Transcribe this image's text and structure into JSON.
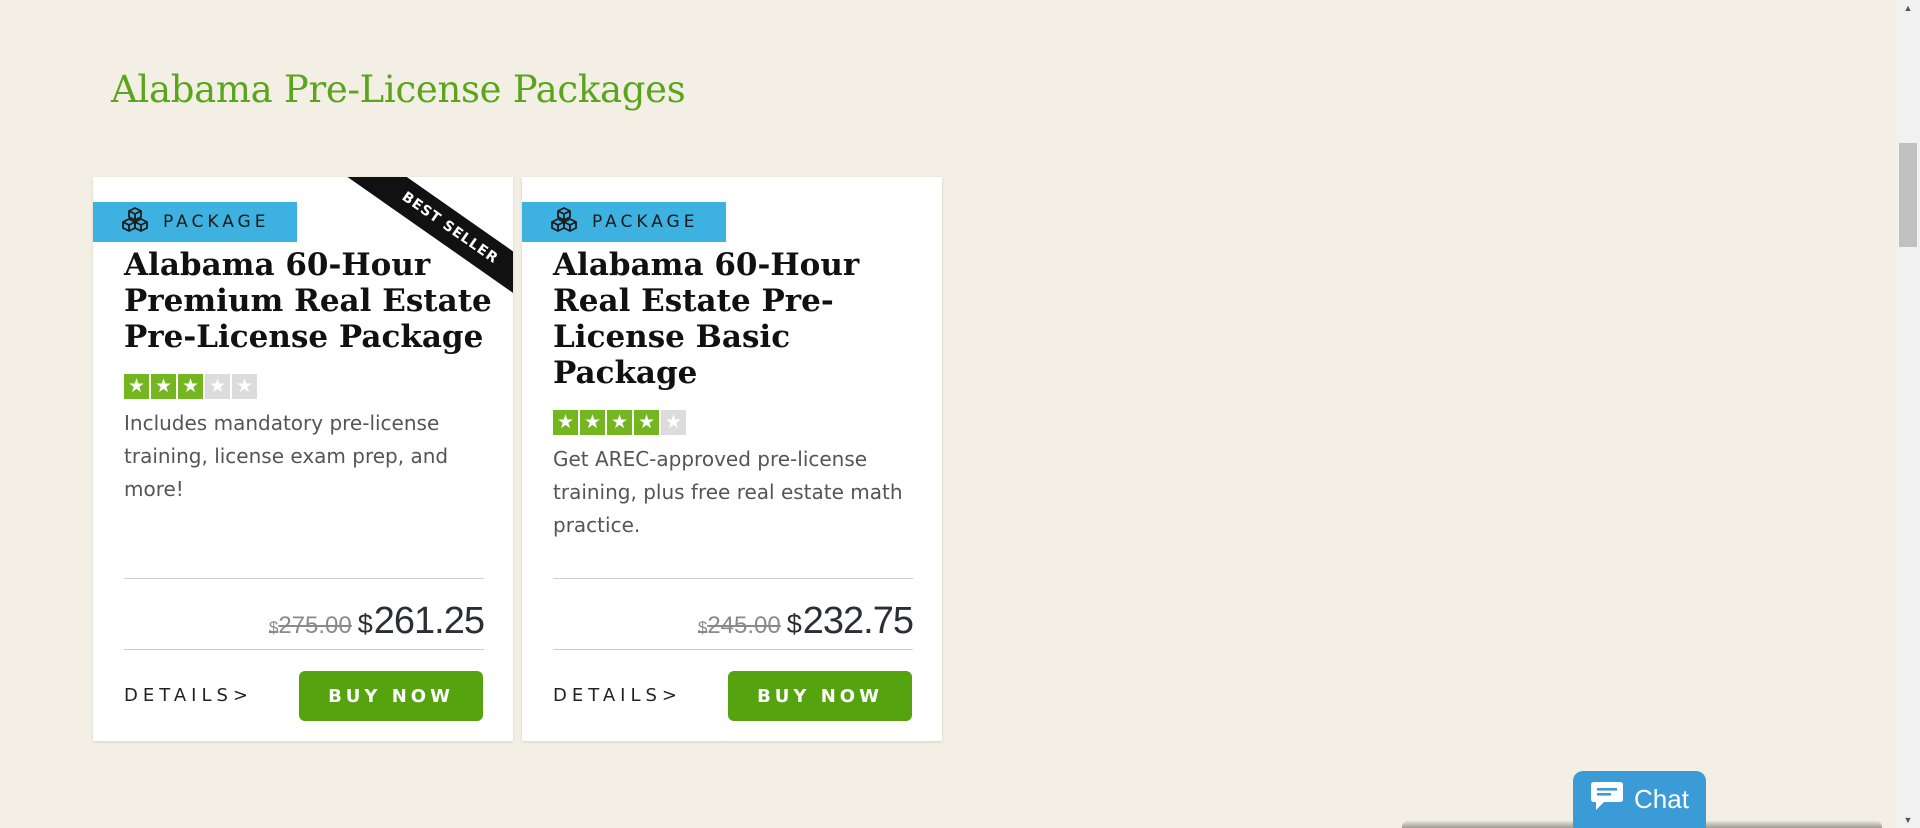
{
  "section": {
    "title": "Alabama Pre-License Packages"
  },
  "cards": [
    {
      "badge": "PACKAGE",
      "ribbon": "BEST SELLER",
      "title": "Alabama 60-Hour Premium Real Estate Pre-License Package",
      "rating": 3,
      "rating_max": 5,
      "description": "Includes mandatory pre-license training, license exam prep, and more!",
      "currency": "$",
      "old_price": "275.00",
      "new_price": "261.25",
      "details_label": "DETAILS>",
      "buy_label": "BUY NOW"
    },
    {
      "badge": "PACKAGE",
      "title": "Alabama 60-Hour Real Estate Pre-License Basic Package",
      "rating": 4,
      "rating_max": 5,
      "description": "Get AREC-approved pre-license training, plus free real estate math practice.",
      "currency": "$",
      "old_price": "245.00",
      "new_price": "232.75",
      "details_label": "DETAILS>",
      "buy_label": "BUY NOW"
    }
  ],
  "chat": {
    "label": "Chat"
  },
  "colors": {
    "background": "#f3efe4",
    "title_green": "#5aa51c",
    "badge_blue": "#3db1e0",
    "star_green": "#73b61f",
    "buy_green": "#54a30f",
    "chat_blue": "#3a9bd6"
  },
  "icons": {
    "badge": "cubes-icon",
    "chat": "chat-bubble-icon",
    "star": "star-icon"
  }
}
